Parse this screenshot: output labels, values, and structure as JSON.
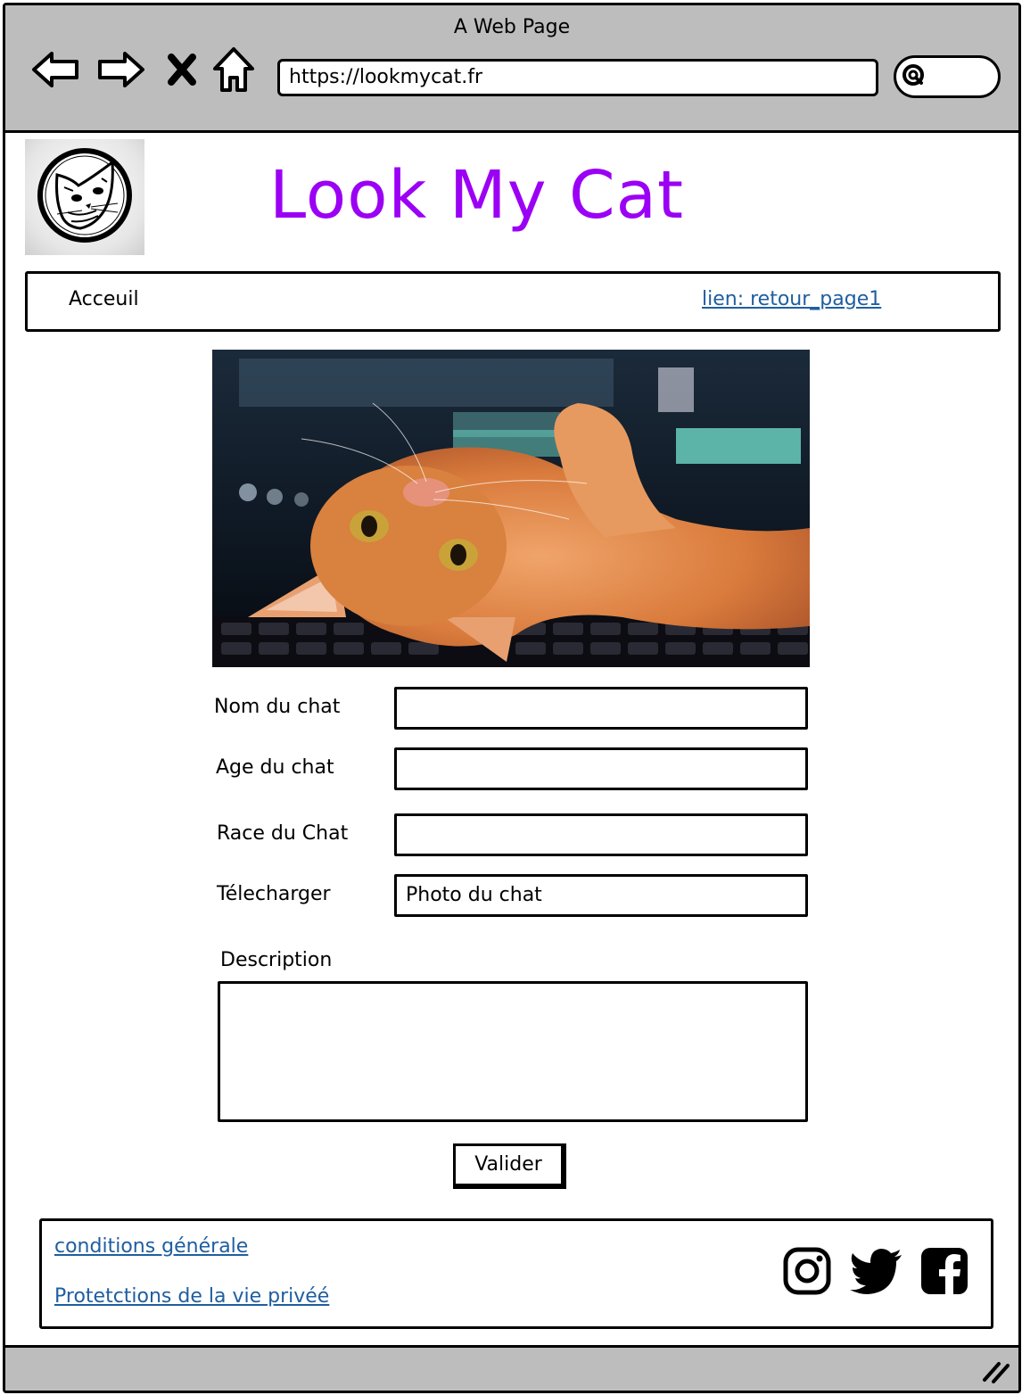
{
  "window": {
    "title": "A Web Page"
  },
  "browser": {
    "url": "https://lookmycat.fr",
    "icons": [
      "back-arrow-icon",
      "forward-arrow-icon",
      "close-icon",
      "home-icon",
      "search-icon",
      "resize-grip-icon"
    ]
  },
  "site": {
    "title": "Look My Cat",
    "title_color": "#9b00f5",
    "logo_icon": "cat-head-logo"
  },
  "nav": {
    "home": "Acceuil",
    "link": "lien: retour_page1",
    "link_color": "#1f5ea0"
  },
  "form": {
    "fields": [
      {
        "label": "Nom du chat",
        "value": ""
      },
      {
        "label": "Age du chat",
        "value": ""
      },
      {
        "label": "Race du Chat",
        "value": ""
      },
      {
        "label": "Télecharger",
        "value": "Photo du chat"
      }
    ],
    "description_label": "Description",
    "submit": "Valider"
  },
  "footer": {
    "links": [
      "conditions générale",
      "Protetctions de la vie privéé"
    ],
    "social_icons": [
      "instagram-icon",
      "twitter-icon",
      "facebook-icon"
    ]
  }
}
